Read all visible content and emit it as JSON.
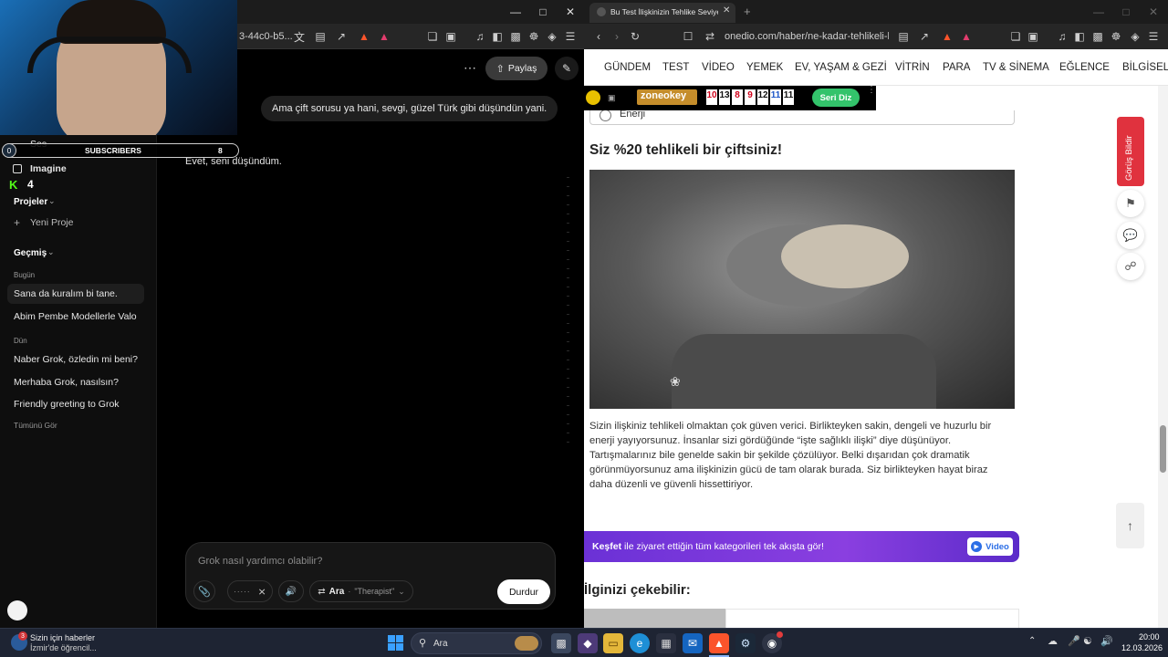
{
  "left_window": {
    "url_fragment": "3-44c0-b5...",
    "share_label": "Paylaş",
    "sidebar": {
      "voice_label": "Ses",
      "imagine_label": "Imagine",
      "projects_header": "Projeler",
      "new_project_label": "Yeni Proje",
      "history_header": "Geçmiş",
      "today_label": "Bugün",
      "today_items": [
        "Sana da kuralım bi tane.",
        "Abim Pembe Modellerle Valor..."
      ],
      "yesterday_label": "Dün",
      "yesterday_items": [
        "Naber Grok, özledin mi beni?",
        "Merhaba Grok, nasılsın?",
        "Friendly greeting to Grok"
      ],
      "see_all_label": "Tümünü Gör"
    },
    "chat": {
      "user_message": "Ama çift sorusu ya hani, sevgi, güzel Türk gibi düşündün yani.",
      "assistant_message": "Evet, seni düşündüm."
    },
    "input": {
      "placeholder": "Grok nasıl yardımcı olabilir?",
      "search_label": "Ara",
      "mode_label": "\"Therapist\"",
      "stop_label": "Durdur"
    }
  },
  "overlay": {
    "subscribers_left": "0",
    "subscribers_label": "SUBSCRIBERS",
    "subscribers_right": "8",
    "kick_count": "4"
  },
  "right_window": {
    "tab_title": "Bu Test İlişkinizin Tehlike Seviyes",
    "url": "onedio.com/haber/ne-kadar-tehlikeli-bir-...",
    "nav_items": [
      "GÜNDEM",
      "TEST",
      "VİDEO",
      "YEMEK",
      "EV, YAŞAM & GEZİ",
      "VİTRİN",
      "PARA",
      "TV & SİNEMA",
      "EĞLENCE",
      "BİLGİSEL"
    ],
    "ad": {
      "brand": "zoneokey",
      "numbers": [
        "10",
        "13",
        "8",
        "9",
        "12",
        "11",
        "11"
      ],
      "number_colors": [
        "#d0021b",
        "#111111",
        "#d0021b",
        "#d0021b",
        "#111111",
        "#1e57c8",
        "#111111"
      ],
      "button_label": "Seri Diz"
    },
    "option_label": "Enerji",
    "result_title": "Siz %20 tehlikeli bir çiftsiniz!",
    "result_text": "Sizin ilişkiniz tehlikeli olmaktan çok güven verici. Birlikteyken sakin, dengeli ve huzurlu bir enerji yayıyorsunuz. İnsanlar sizi gördüğünde “işte sağlıklı ilişki” diye düşünüyor. Tartışmalarınız bile genelde sakin bir şekilde çözülüyor. Belki dışarıdan çok dramatik görünmüyorsunuz ama ilişkinizin gücü de tam olarak burada. Siz birlikteyken hayat biraz daha düzenli ve güvenli hissettiriyor.",
    "feedback_label": "Görüş Bildir",
    "kesfet_bold": "Keşfet",
    "kesfet_text": " ile ziyaret ettiğin tüm kategorileri tek akışta gör!",
    "video_label": "Video",
    "related_title": "İlginizi çekebilir:"
  },
  "taskbar": {
    "news_title": "Sizin için haberler",
    "news_subtitle": "İzmir'de öğrencil...",
    "news_badge": "3",
    "search_placeholder": "Ara",
    "time": "20:00",
    "date": "12.03.2026"
  }
}
